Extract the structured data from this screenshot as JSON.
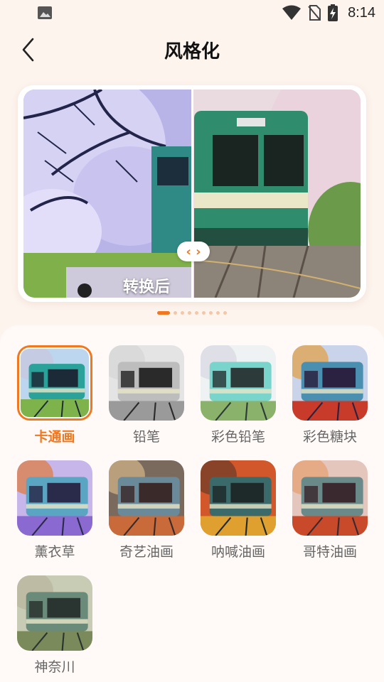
{
  "status_bar": {
    "time": "8:14",
    "icons": [
      "image-icon",
      "wifi-icon",
      "no-sim-icon",
      "battery-charging-icon"
    ]
  },
  "header": {
    "title": "风格化",
    "back_icon": "chevron-left-icon"
  },
  "preview": {
    "after_label": "转换后",
    "handle_icon": "swap-horizontal-icon",
    "page_count": 9,
    "active_page": 1
  },
  "styles": [
    {
      "label": "卡通画",
      "selected": true
    },
    {
      "label": "铅笔",
      "selected": false
    },
    {
      "label": "彩色铅笔",
      "selected": false
    },
    {
      "label": "彩色糖块",
      "selected": false
    },
    {
      "label": "薰衣草",
      "selected": false
    },
    {
      "label": "奇艺油画",
      "selected": false
    },
    {
      "label": "呐喊油画",
      "selected": false
    },
    {
      "label": "哥特油画",
      "selected": false
    },
    {
      "label": "神奈川",
      "selected": false
    }
  ],
  "colors": {
    "accent": "#f07820",
    "background": "#fdf4ee"
  }
}
